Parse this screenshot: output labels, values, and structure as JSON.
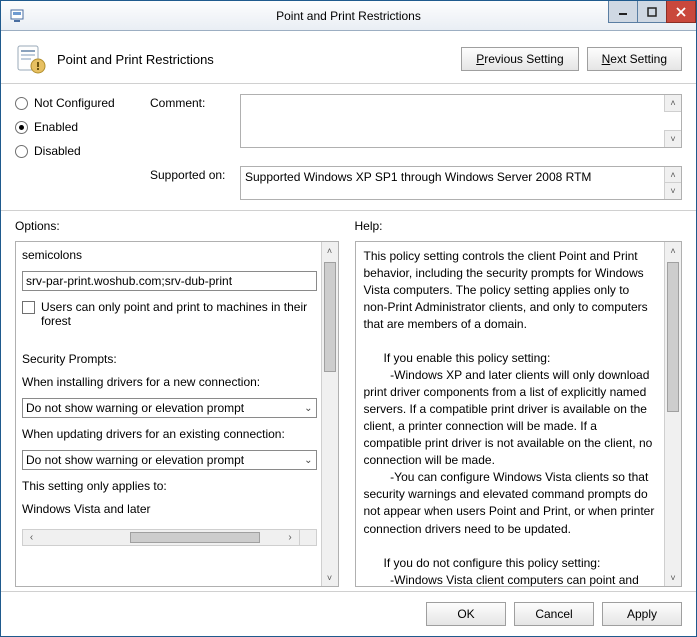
{
  "window": {
    "title": "Point and Print Restrictions"
  },
  "header": {
    "page_title": "Point and Print Restrictions",
    "prev_prefix": "P",
    "prev_rest": "revious Setting",
    "next_prefix": "N",
    "next_rest": "ext Setting"
  },
  "config": {
    "radio_not_configured": "Not Configured",
    "radio_enabled": "Enabled",
    "radio_disabled": "Disabled",
    "selected": "enabled",
    "comment_label": "Comment:",
    "comment_value": "",
    "supported_label": "Supported on:",
    "supported_value": "Supported Windows XP SP1 through Windows Server 2008 RTM"
  },
  "panes": {
    "options_label": "Options:",
    "help_label": "Help:"
  },
  "options": {
    "top_line": "semicolons",
    "servers_value": "srv-par-print.woshub.com;srv-dub-print",
    "forest_checkbox_label": "Users can only point and print to machines in their forest",
    "security_prompts_heading": "Security Prompts:",
    "install_label": "When installing drivers for a new connection:",
    "install_value": "Do not show warning or elevation prompt",
    "update_label": "When updating drivers for an existing connection:",
    "update_value": "Do not show warning or elevation prompt",
    "applies_label": "This setting only applies to:",
    "applies_value": "Windows Vista and later"
  },
  "help": {
    "text": "This policy setting controls the client Point and Print behavior, including the security prompts for Windows Vista computers. The policy setting applies only to non-Print Administrator clients, and only to computers that are members of a domain.\n\n      If you enable this policy setting:\n        -Windows XP and later clients will only download print driver components from a list of explicitly named servers. If a compatible print driver is available on the client, a printer connection will be made. If a compatible print driver is not available on the client, no connection will be made.\n        -You can configure Windows Vista clients so that security warnings and elevated command prompts do not appear when users Point and Print, or when printer connection drivers need to be updated.\n\n      If you do not configure this policy setting:\n        -Windows Vista client computers can point and print to any server.\n        -Windows Vista computers will show a warning and an elevated command prompt when users create a printer"
  },
  "footer": {
    "ok": "OK",
    "cancel": "Cancel",
    "apply": "Apply"
  }
}
